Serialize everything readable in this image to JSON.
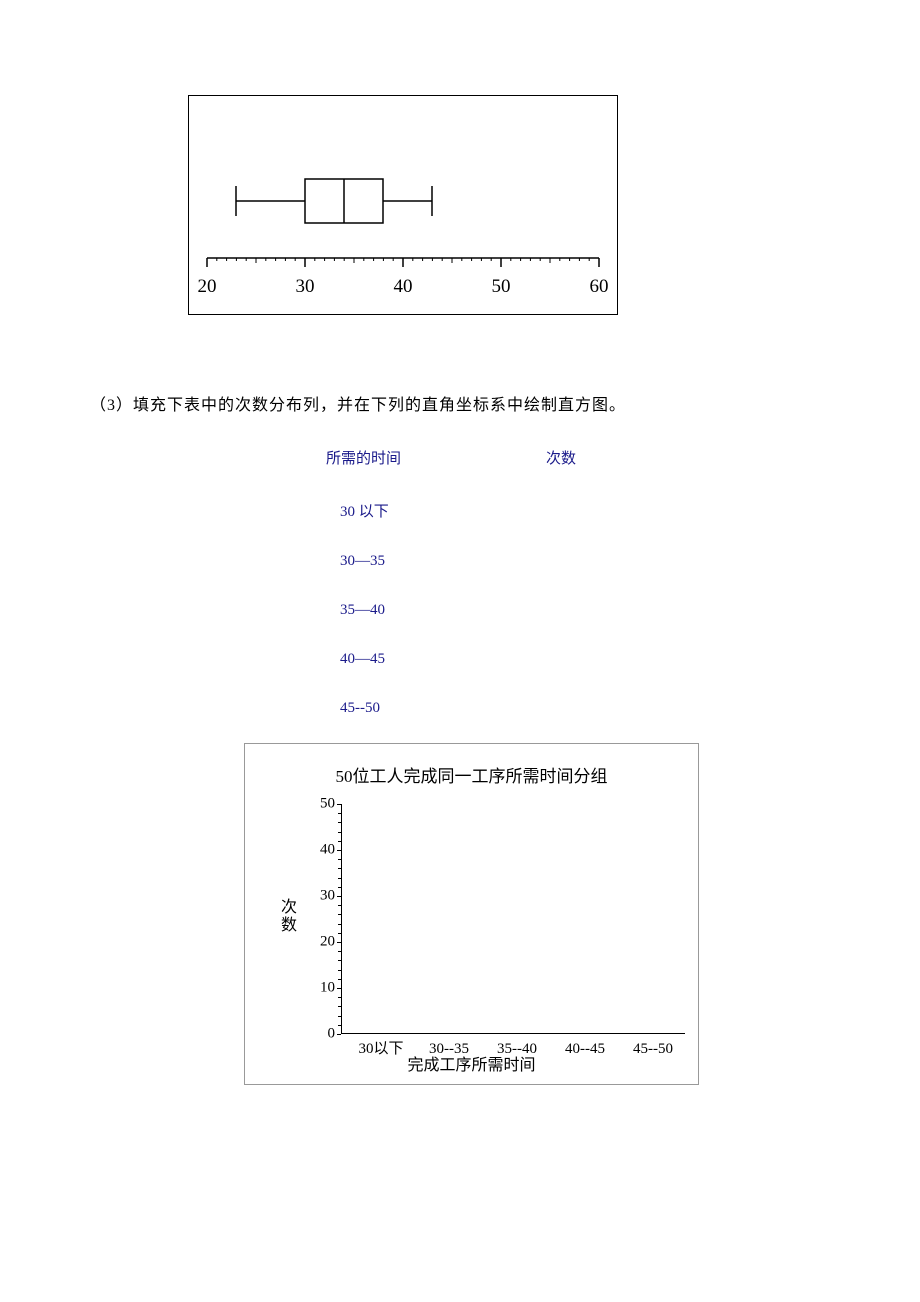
{
  "chart_data": [
    {
      "type": "boxplot",
      "axis_ticks": [
        20,
        30,
        40,
        50,
        60
      ],
      "xlim": [
        20,
        60
      ],
      "min": 23,
      "q1": 30,
      "median": 34,
      "q3": 38,
      "max": 43
    },
    {
      "type": "bar",
      "title": "50位工人完成同一工序所需时间分组",
      "xlabel": "完成工序所需时间",
      "ylabel": "次数",
      "categories": [
        "30以下",
        "30--35",
        "35--40",
        "40--45",
        "45--50"
      ],
      "values": [
        null,
        null,
        null,
        null,
        null
      ],
      "ylim": [
        0,
        50
      ],
      "y_ticks": [
        0,
        10,
        20,
        30,
        40,
        50
      ]
    }
  ],
  "question": {
    "number": "（3）",
    "text": "填充下表中的次数分布列，并在下列的直角坐标系中绘制直方图。"
  },
  "freq_table": {
    "header_time": "所需的时间",
    "header_count": "次数",
    "rows": [
      "30 以下",
      "30—35",
      "35—40",
      "40—45",
      "45--50"
    ]
  }
}
